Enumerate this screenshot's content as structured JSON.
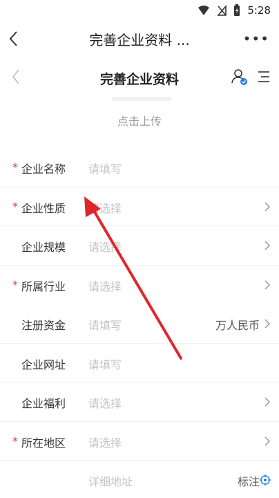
{
  "status_bar": {
    "time": "5:28",
    "icons": [
      "wifi-icon",
      "no-signal-icon",
      "battery-icon"
    ]
  },
  "outer_nav": {
    "title": "完善企业资料 ...",
    "more": "•••"
  },
  "inner_nav": {
    "title": "完善企业资料"
  },
  "upload": {
    "label": "点击上传"
  },
  "form": {
    "required_mark": "*",
    "rows": [
      {
        "label": "企业名称",
        "value": "请填写"
      },
      {
        "label": "企业性质",
        "value": "请选择"
      },
      {
        "label": "企业规模",
        "value": "请选择"
      },
      {
        "label": "所属行业",
        "value": "请选择"
      },
      {
        "label": "注册资金",
        "value": "请填写",
        "suffix": "万人民币"
      },
      {
        "label": "企业网址",
        "value": "请填写"
      },
      {
        "label": "企业福利",
        "value": "请选择"
      },
      {
        "label": "所在地区",
        "value": "请选择"
      },
      {
        "value": "详细地址",
        "suffix": "标注"
      }
    ]
  },
  "colors": {
    "required": "#e23a3a",
    "placeholder": "#c4c4c4",
    "accent": "#1f7fe5",
    "annotation_arrow": "#e0262b"
  }
}
